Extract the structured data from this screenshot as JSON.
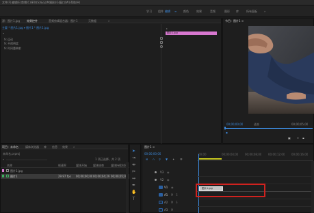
{
  "menu": [
    "文件(F)",
    "编辑(E)",
    "剪辑(C)",
    "序列(S)",
    "标记(M)",
    "图形(G)",
    "窗口(W)",
    "帮助(H)"
  ],
  "workspaces": [
    "学习",
    "组件",
    "编辑",
    "颜色",
    "效果",
    "音频",
    "图形",
    "库",
    "所有面板"
  ],
  "active_workspace": 2,
  "source_panel": {
    "tabs": [
      "源：图片1.jpg",
      "效果控件",
      "音频剪辑混合器：图片1",
      "元数据"
    ],
    "active_tab": 1,
    "header": "主要 * 图片1.jpg ▾  图片1 * 图片1.jpg",
    "rows": [
      "fx 运动",
      "fx 不透明度",
      "fx 时间重映射"
    ],
    "clip_label": "图片1.jpg"
  },
  "program_panel": {
    "title": "节目：图片1 ≡",
    "timecode": "00;00;00;00",
    "fit": "适合",
    "duration": "00;00;05;00"
  },
  "project_panel": {
    "tabs": [
      "项目：未命名",
      "媒体浏览器",
      "库",
      "信息",
      "效果"
    ],
    "active_tab": 0,
    "file": "未命名.prproj",
    "item_count": "1 项已选择，共 2 项",
    "columns": [
      "名称",
      "帧速率",
      "媒体开始",
      "媒体结束",
      "媒体持续时间"
    ],
    "items": [
      {
        "name": "图片1.jpg",
        "rate": "",
        "start": "",
        "end": "",
        "dur": ""
      },
      {
        "name": "图片1",
        "rate": "29.97 fps",
        "start": "00;00;00;00",
        "end": "00;00;04;29",
        "dur": "00;00;05;00"
      }
    ]
  },
  "timeline": {
    "tab": "图片1 ≡",
    "timecode": "00;00;00;00",
    "ruler": [
      "00;00",
      "00;00;04;00",
      "00;00;08;00",
      "00;00;12;00",
      "00;00;16;00"
    ],
    "tracks": [
      "V3",
      "V2",
      "V1",
      "A1",
      "A2",
      "A3"
    ],
    "clip_label": "图片1.jpg"
  },
  "colors": {
    "accent": "#3d8bde",
    "clip": "#d878d0",
    "highlight_box": "#d0221f"
  }
}
